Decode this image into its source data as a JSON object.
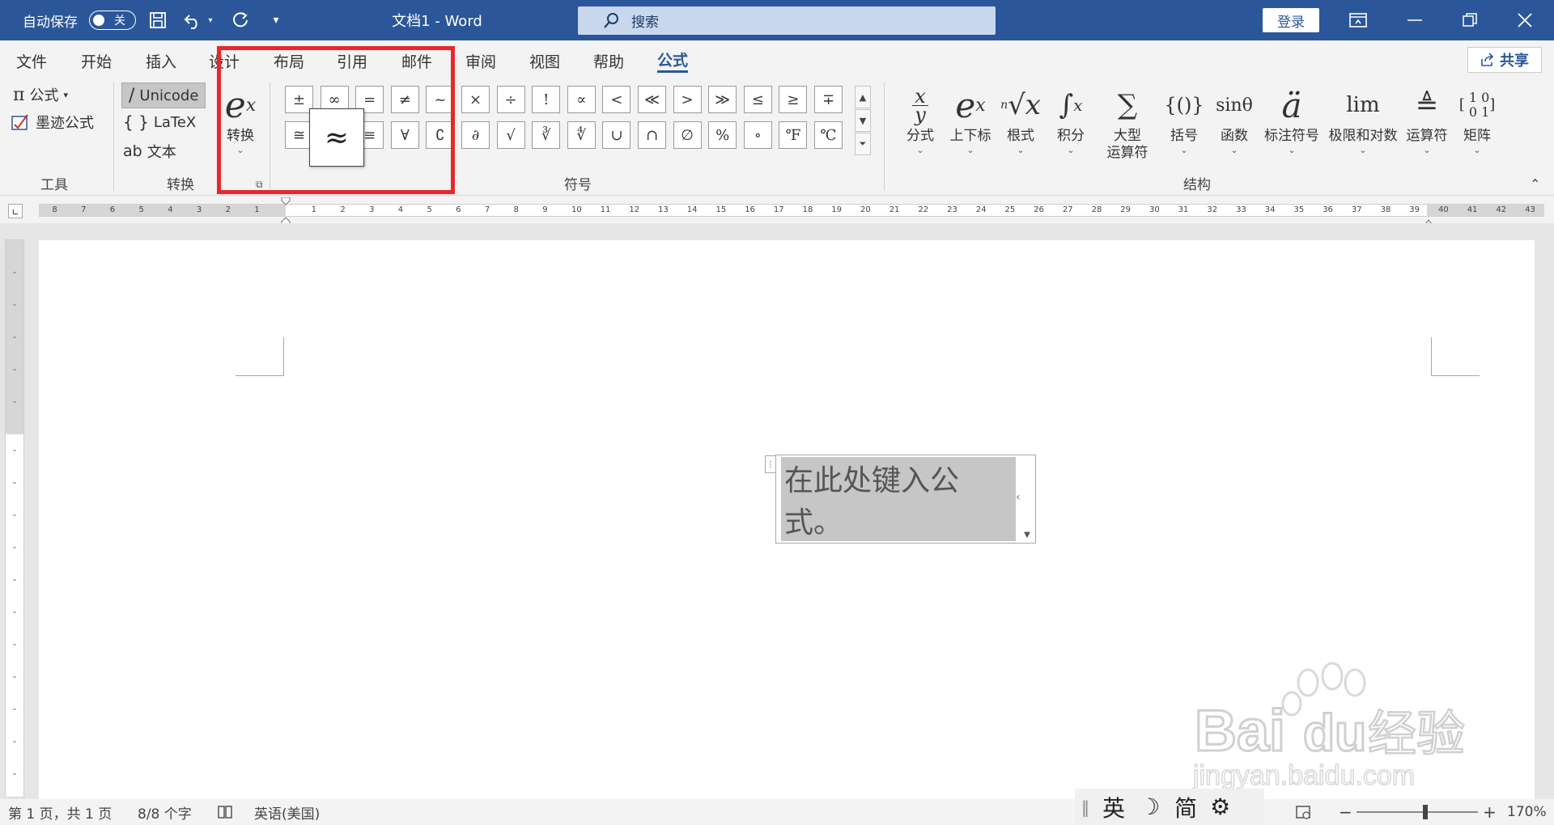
{
  "titlebar": {
    "autosave_label": "自动保存",
    "autosave_state": "关",
    "doc_title": "文档1  -  Word",
    "search_placeholder": "搜索",
    "login_label": "登录"
  },
  "tabs": [
    "文件",
    "开始",
    "插入",
    "设计",
    "布局",
    "引用",
    "邮件",
    "审阅",
    "视图",
    "帮助",
    "公式"
  ],
  "active_tab": "公式",
  "share_label": "共享",
  "tools_group": {
    "equation_label": "公式",
    "ink_label": "墨迹公式",
    "group_label": "工具"
  },
  "convert_group": {
    "unicode_label": "Unicode",
    "latex_label": "LaTeX",
    "text_label": "文本",
    "convert_label": "转换",
    "group_label": "转换"
  },
  "symbols_group": {
    "row1": [
      "±",
      "∞",
      "=",
      "≠",
      "~",
      "×",
      "÷",
      "!",
      "∝",
      "<",
      "≪",
      ">",
      "≫",
      "≤",
      "≥",
      "∓"
    ],
    "row2": [
      "≅",
      "≈",
      "≡",
      "∀",
      "∁",
      "∂",
      "√",
      "∛",
      "∜",
      "∪",
      "∩",
      "∅",
      "%",
      "∘",
      "℉",
      "℃"
    ],
    "group_label": "符号",
    "tooltip_symbol": "≈"
  },
  "structures_group": {
    "items": [
      {
        "label": "分式"
      },
      {
        "label": "上下标"
      },
      {
        "label": "根式"
      },
      {
        "label": "积分"
      },
      {
        "label": "大型",
        "label2": "运算符"
      },
      {
        "label": "括号"
      },
      {
        "label": "函数"
      },
      {
        "label": "标注符号"
      },
      {
        "label": "极限和对数"
      },
      {
        "label": "运算符"
      },
      {
        "label": "矩阵"
      }
    ],
    "group_label": "结构"
  },
  "ruler": {
    "left_numbers": [
      "8",
      "7",
      "6",
      "5",
      "4",
      "3",
      "2",
      "1"
    ],
    "right_numbers": [
      "1",
      "2",
      "3",
      "4",
      "5",
      "6",
      "7",
      "8",
      "9",
      "10",
      "11",
      "12",
      "13",
      "14",
      "15",
      "16",
      "17",
      "18",
      "19",
      "20",
      "21",
      "22",
      "23",
      "24",
      "25",
      "26",
      "27",
      "28",
      "29",
      "30",
      "31",
      "32",
      "33",
      "34",
      "35",
      "36",
      "37",
      "38",
      "39",
      "40",
      "41",
      "42",
      "43"
    ]
  },
  "document": {
    "equation_placeholder": "在此处键入公式。"
  },
  "statusbar": {
    "page_info": "第 1 页，共 1 页",
    "word_count": "8/8 个字",
    "language": "英语(美国)",
    "zoom": "170%"
  },
  "ime": {
    "mode": "英",
    "width": "简"
  },
  "watermark": {
    "text1": "Bai",
    "text2": "du",
    "text3": "经验",
    "url": "jingyan.baidu.com"
  },
  "colors": {
    "title_bar": "#2b579a",
    "highlight": "#e8272a",
    "equation_field": "#c6c6c6"
  }
}
